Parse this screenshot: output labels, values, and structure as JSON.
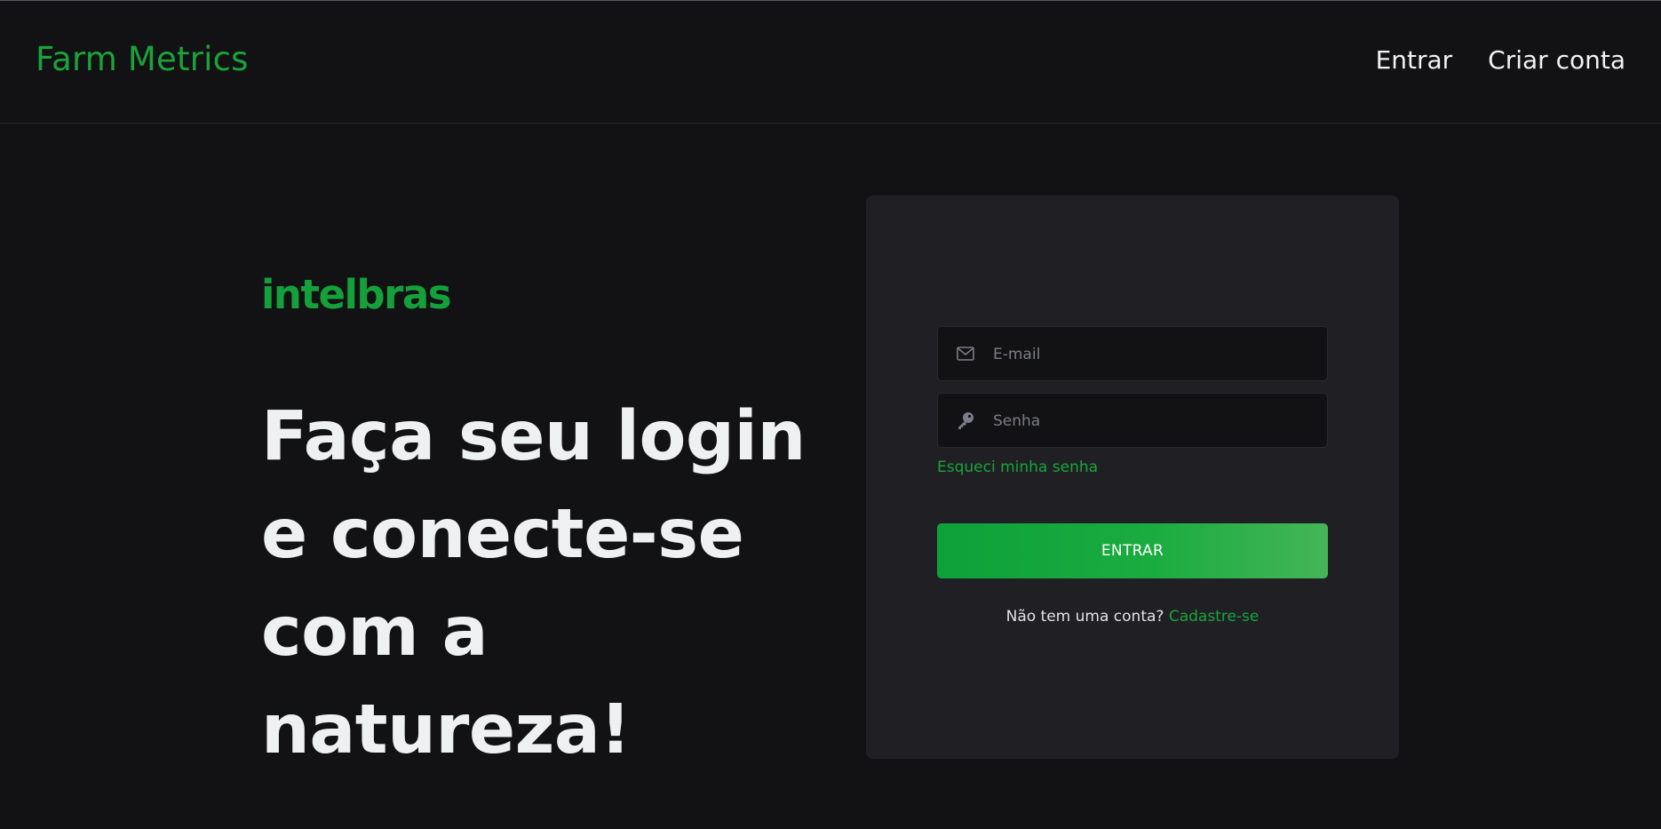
{
  "header": {
    "brand": "Farm Metrics",
    "nav": [
      "Entrar",
      "Criar conta"
    ]
  },
  "hero": {
    "logo_text": "intelbras",
    "headline": "Faça seu login e conecte-se com a natureza!"
  },
  "login_form": {
    "email_placeholder": "E-mail",
    "password_placeholder": "Senha",
    "forgot_password": "Esqueci minha senha",
    "submit_label": "ENTRAR",
    "signup_prompt": "Não tem uma conta?",
    "signup_link": "Cadastre-se",
    "email_icon": "envelope-icon",
    "password_icon": "key-icon"
  },
  "colors": {
    "background": "#121214",
    "card": "#202024",
    "accent": "#1aa33a"
  }
}
